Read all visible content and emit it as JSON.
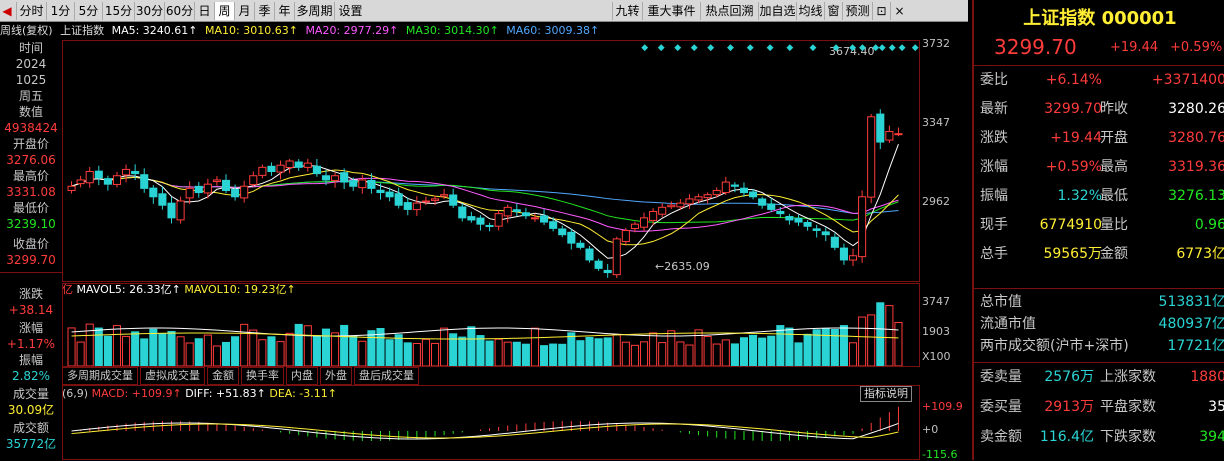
{
  "toolbar": {
    "left": [
      "分时",
      "1分",
      "5分",
      "15分",
      "30分",
      "60分",
      "日",
      "周",
      "月",
      "季",
      "年",
      "多周期",
      "设置"
    ],
    "active": "周",
    "right": [
      "九转",
      "重大事件",
      "热点回溯",
      "加自选",
      "均线",
      "窗",
      "预测"
    ]
  },
  "main_legend": {
    "title": "周线(复权)",
    "name": "上证指数",
    "ma5": "MA5: 3240.61↑",
    "ma10": "MA10: 3010.63↑",
    "ma20": "MA20: 2977.29↑",
    "ma30": "MA30: 3014.30↑",
    "ma60": "MA60: 3009.38↑"
  },
  "info": {
    "time_label": "时间",
    "year": "2024",
    "date": "1025",
    "weekday": "周五",
    "value_label": "数值",
    "value": "4938424",
    "open_label": "开盘价",
    "open": "3276.06",
    "high_label": "最高价",
    "high": "3331.08",
    "low_label": "最低价",
    "low": "3239.10",
    "close_label": "收盘价",
    "close": "3299.70",
    "chg_label": "涨跌",
    "chg": "+38.14",
    "pct_label": "涨幅",
    "pct": "+1.17%",
    "amp_label": "振幅",
    "amp": "2.82%",
    "vol_label": "成交量",
    "vol": "30.09亿",
    "amt_label": "成交额",
    "amt": "35772亿"
  },
  "price_axis": [
    "3732",
    "3347",
    "2962"
  ],
  "price_marks": {
    "high": "3674.40",
    "low": "2635.09"
  },
  "vol_legend": {
    "unit": "亿",
    "mavol5": "MAVOL5: 26.33亿↑",
    "mavol10": "MAVOL10: 19.23亿↑"
  },
  "vol_axis": [
    "3747",
    "1903",
    "X100"
  ],
  "sub_tabs": [
    "多周期成交量",
    "虚拟成交量",
    "金额",
    "换手率",
    "内盘",
    "外盘",
    "盘后成交量"
  ],
  "macd_legend": {
    "params": "(6,9)",
    "macd": "MACD: +109.9↑",
    "diff": "DIFF: +51.83↑",
    "dea": "DEA: -3.11↑",
    "explain": "指标说明"
  },
  "macd_axis": [
    "+109.9",
    "+0",
    "-115.6"
  ],
  "quote": {
    "name": "上证指数",
    "code": "000001",
    "price": "3299.70",
    "chg": "+19.44",
    "pct": "+0.59%",
    "rows": [
      {
        "l1": "委比",
        "v1": "+6.14%",
        "l2": "",
        "v2": "+3371400"
      },
      {
        "l1": "最新",
        "v1": "3299.70",
        "l2": "昨收",
        "v2": "3280.26"
      },
      {
        "l1": "涨跌",
        "v1": "+19.44",
        "l2": "开盘",
        "v2": "3280.76"
      },
      {
        "l1": "涨幅",
        "v1": "+0.59%",
        "l2": "最高",
        "v2": "3319.36"
      },
      {
        "l1": "振幅",
        "v1": "1.32%",
        "l2": "最低",
        "v2": "3276.13"
      },
      {
        "l1": "现手",
        "v1": "6774910",
        "l2": "量比",
        "v2": "0.96"
      },
      {
        "l1": "总手",
        "v1": "59565万",
        "l2": "金额",
        "v2": "6773亿"
      }
    ],
    "market": [
      {
        "l": "总市值",
        "v": "513831亿"
      },
      {
        "l": "流通市值",
        "v": "480937亿"
      },
      {
        "l": "两市成交额(沪市+深市)",
        "v": "17721亿"
      }
    ],
    "bottom": [
      {
        "l1": "委卖量",
        "v1": "2576万",
        "l2": "上涨家数",
        "v2": "1880"
      },
      {
        "l1": "委买量",
        "v1": "2913万",
        "l2": "平盘家数",
        "v2": "35"
      },
      {
        "l1": "卖金额",
        "v1": "116.4亿",
        "l2": "下跌家数",
        "v2": "394"
      }
    ]
  },
  "chart_data": {
    "type": "candlestick",
    "title": "上证指数 周线(复权)",
    "y_range": [
      2600,
      3740
    ],
    "y_ticks": [
      3732,
      3347,
      2962
    ],
    "series_close": [
      3050,
      3080,
      3120,
      3090,
      3060,
      3100,
      3130,
      3110,
      3040,
      3000,
      2960,
      2900,
      2980,
      3040,
      3020,
      3060,
      3080,
      3030,
      3000,
      3050,
      3100,
      3140,
      3120,
      3150,
      3170,
      3140,
      3160,
      3110,
      3080,
      3100,
      3070,
      3050,
      3080,
      3040,
      3020,
      3000,
      2960,
      2940,
      2970,
      2980,
      2990,
      3010,
      2960,
      2900,
      2890,
      2870,
      2860,
      2920,
      2950,
      2930,
      2910,
      2900,
      2880,
      2850,
      2820,
      2780,
      2760,
      2700,
      2660,
      2640,
      2800,
      2840,
      2870,
      2900,
      2930,
      2950,
      2960,
      2970,
      2990,
      3000,
      3010,
      3030,
      3070,
      3050,
      3020,
      3000,
      2960,
      2940,
      2920,
      2890,
      2880,
      2860,
      2840,
      2820,
      2760,
      2700,
      2720,
      3000,
      3380,
      3260,
      3310,
      3299.7
    ]
  }
}
